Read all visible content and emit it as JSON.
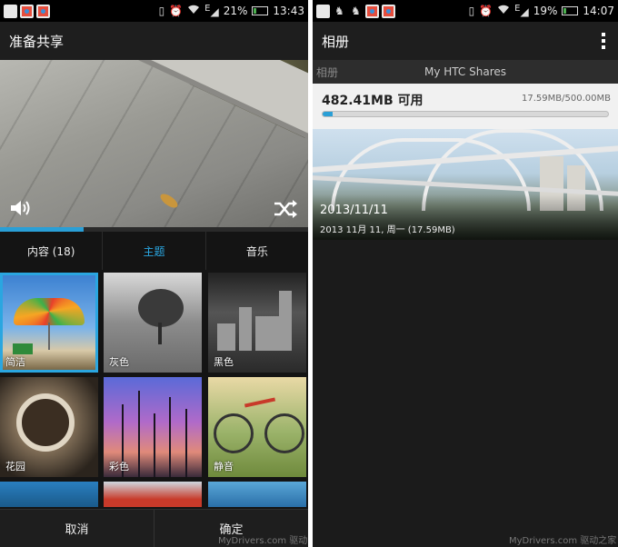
{
  "left": {
    "status": {
      "battery": "21%",
      "time": "13:43",
      "signal_label": "E",
      "battery_level": 0.21
    },
    "title": "准备共享",
    "video_progress": 0.27,
    "tabs": [
      {
        "label": "内容 (18)",
        "active": false
      },
      {
        "label": "主题",
        "active": true
      },
      {
        "label": "音乐",
        "active": false
      }
    ],
    "themes": [
      {
        "label": "简洁",
        "selected": true
      },
      {
        "label": "灰色",
        "selected": false
      },
      {
        "label": "黑色",
        "selected": false
      },
      {
        "label": "花园",
        "selected": false
      },
      {
        "label": "彩色",
        "selected": false
      },
      {
        "label": "静音",
        "selected": false
      }
    ],
    "buttons": {
      "cancel": "取消",
      "confirm": "确定"
    },
    "watermark": "MyDrivers.com 驱动之家"
  },
  "right": {
    "status": {
      "battery": "19%",
      "time": "14:07",
      "signal_label": "E",
      "battery_level": 0.19
    },
    "title": "相册",
    "subtitle_prev": "相册",
    "subtitle": "My HTC Shares",
    "storage": {
      "available": "482.41MB 可用",
      "used": "17.59MB/500.00MB",
      "used_fraction": 0.035
    },
    "album": {
      "date": "2013/11/11",
      "meta": "2013 11月 11, 周一 (17.59MB)"
    },
    "watermark": "MyDrivers.com 驱动之家"
  },
  "colors": {
    "accent": "#2aa6e0",
    "background": "#141414",
    "storage_bg": "#f1f1f1"
  },
  "icons": [
    "volume-icon",
    "shuffle-icon",
    "wifi-icon",
    "alarm-icon",
    "vibrate-icon",
    "battery-icon",
    "overflow-menu-icon"
  ]
}
